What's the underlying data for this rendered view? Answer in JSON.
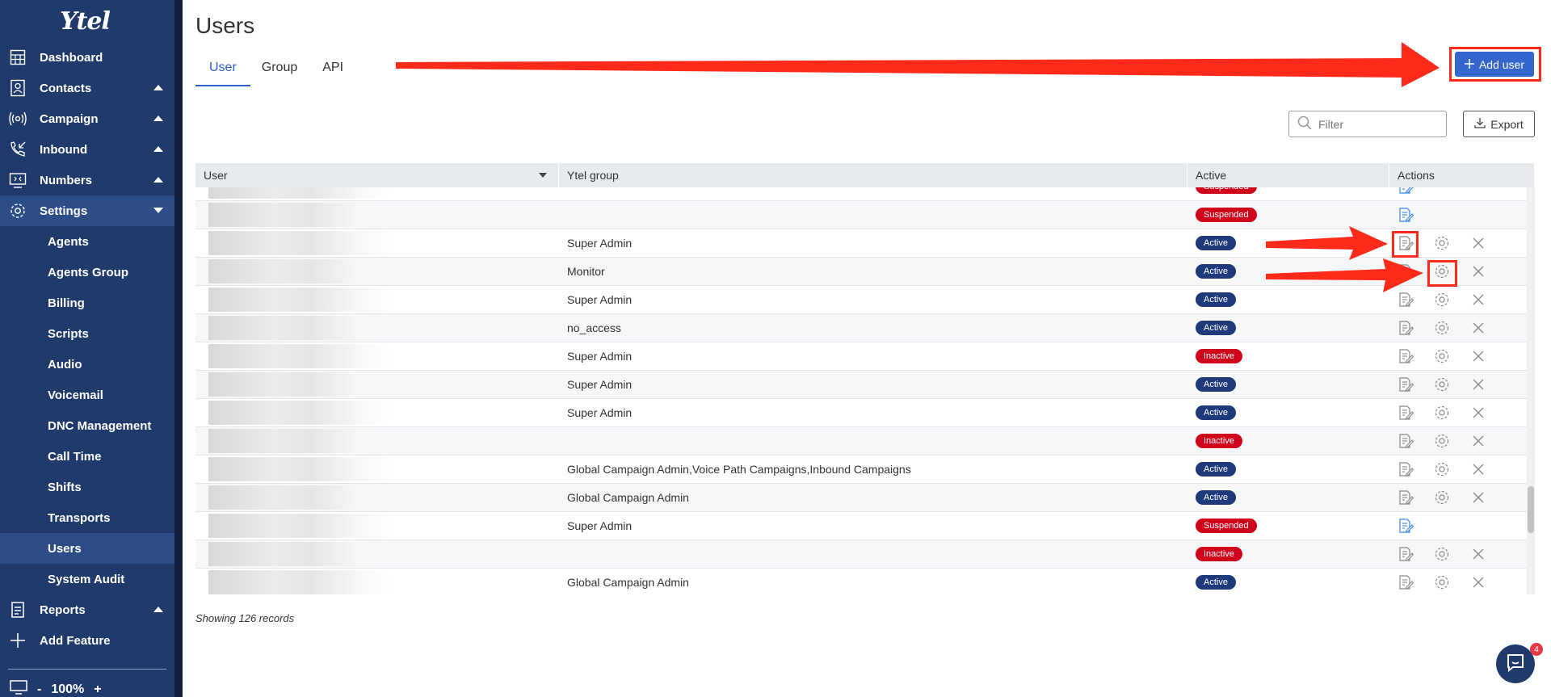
{
  "app": {
    "logo": "Ytel"
  },
  "sidebar": {
    "items": [
      {
        "label": "Dashboard",
        "icon": "dashboard-icon",
        "caret": ""
      },
      {
        "label": "Contacts",
        "icon": "contacts-icon",
        "caret": "up"
      },
      {
        "label": "Campaign",
        "icon": "campaign-icon",
        "caret": "up"
      },
      {
        "label": "Inbound",
        "icon": "inbound-icon",
        "caret": "up"
      },
      {
        "label": "Numbers",
        "icon": "numbers-icon",
        "caret": "up"
      },
      {
        "label": "Settings",
        "icon": "settings-icon",
        "caret": "down"
      }
    ],
    "settings_sub": [
      "Agents",
      "Agents Group",
      "Billing",
      "Scripts",
      "Audio",
      "Voicemail",
      "DNC Management",
      "Call Time",
      "Shifts",
      "Transports",
      "Users",
      "System Audit"
    ],
    "reports_label": "Reports",
    "add_feature_label": "Add Feature",
    "zoom": {
      "minus": "-",
      "level": "100%",
      "plus": "+"
    }
  },
  "page": {
    "title": "Users",
    "tabs": [
      "User",
      "Group",
      "API"
    ],
    "add_user_label": "Add user",
    "filter_placeholder": "Filter",
    "export_label": "Export",
    "records_text": "Showing 126 records"
  },
  "table": {
    "columns": [
      "User",
      "Ytel group",
      "Active",
      "Actions"
    ],
    "rows": [
      {
        "group": "",
        "status": "Suspended",
        "status_kind": "suspended",
        "actions": "edit"
      },
      {
        "group": "",
        "status": "Suspended",
        "status_kind": "suspended",
        "actions": "edit"
      },
      {
        "group": "Super Admin",
        "status": "Active",
        "status_kind": "active",
        "actions": "all"
      },
      {
        "group": "Monitor",
        "status": "Active",
        "status_kind": "active",
        "actions": "all"
      },
      {
        "group": "Super Admin",
        "status": "Active",
        "status_kind": "active",
        "actions": "all"
      },
      {
        "group": "no_access",
        "status": "Active",
        "status_kind": "active",
        "actions": "all"
      },
      {
        "group": "Super Admin",
        "status": "Inactive",
        "status_kind": "inactive",
        "actions": "all"
      },
      {
        "group": "Super Admin",
        "status": "Active",
        "status_kind": "active",
        "actions": "all"
      },
      {
        "group": "Super Admin",
        "status": "Active",
        "status_kind": "active",
        "actions": "all"
      },
      {
        "group": "",
        "status": "Inactive",
        "status_kind": "inactive",
        "actions": "all"
      },
      {
        "group": "Global Campaign Admin,Voice Path Campaigns,Inbound Campaigns",
        "status": "Active",
        "status_kind": "active",
        "actions": "all"
      },
      {
        "group": "Global Campaign Admin",
        "status": "Active",
        "status_kind": "active",
        "actions": "all"
      },
      {
        "group": "Super Admin",
        "status": "Suspended",
        "status_kind": "suspended",
        "actions": "edit"
      },
      {
        "group": "",
        "status": "Inactive",
        "status_kind": "inactive",
        "actions": "all"
      },
      {
        "group": "Global Campaign Admin",
        "status": "Active",
        "status_kind": "active",
        "actions": "all"
      }
    ]
  },
  "chat": {
    "badge_count": "4"
  },
  "colors": {
    "sidebar": "#1f3a6b",
    "accent": "#3466cd",
    "active_badge": "#1f3a7a",
    "inactive_badge": "#d0021b",
    "annotation": "#ff2a1a"
  }
}
